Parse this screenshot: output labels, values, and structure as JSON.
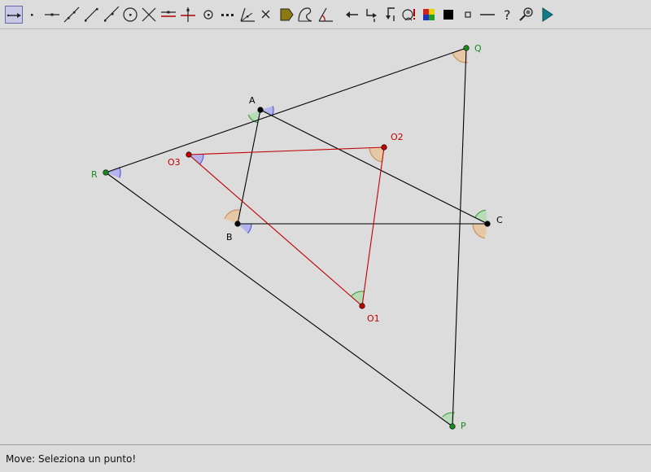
{
  "toolbar": {
    "tools": [
      {
        "name": "move-tool-icon",
        "selected": true
      },
      {
        "name": "new-point-icon"
      },
      {
        "name": "point-on-line-icon"
      },
      {
        "name": "line-through-two-points-icon"
      },
      {
        "name": "segment-icon"
      },
      {
        "name": "ray-icon"
      },
      {
        "name": "circle-icon"
      },
      {
        "name": "intersect-icon"
      },
      {
        "name": "parallel-line-icon"
      },
      {
        "name": "perpendicular-line-icon"
      },
      {
        "name": "midpoint-icon"
      },
      {
        "name": "dotted-line-icon"
      },
      {
        "name": "angle-bisector-icon"
      },
      {
        "name": "delete-x-icon"
      },
      {
        "name": "polygon-icon"
      },
      {
        "name": "locus-icon"
      },
      {
        "name": "angle-icon"
      },
      {
        "name": "translate-arrow-icon"
      },
      {
        "name": "rotate-icon"
      },
      {
        "name": "reflect-icon"
      },
      {
        "name": "macro-icon"
      },
      {
        "name": "color-palette-icon"
      },
      {
        "name": "fill-square-icon"
      },
      {
        "name": "small-square-icon"
      },
      {
        "name": "line-style-icon"
      },
      {
        "name": "help-question-icon"
      },
      {
        "name": "zoom-magnifier-icon"
      },
      {
        "name": "play-animation-icon"
      }
    ]
  },
  "colors": {
    "black": "#000000",
    "red_line": "#c00000",
    "green_point": "#1a8a1a",
    "angle_blue": "#5050d8",
    "angle_blue_fill": "#b4b4ec",
    "angle_orange": "#c8905a",
    "angle_orange_fill": "#e6c7a6",
    "angle_green": "#3a9a3a",
    "angle_green_fill": "#b8dcb8"
  },
  "labels": {
    "A": "A",
    "B": "B",
    "C": "C",
    "P": "P",
    "Q": "Q",
    "R": "R",
    "O1": "O1",
    "O2": "O2",
    "O3": "O3"
  },
  "status": {
    "text": "Move: Seleziona un punto!"
  }
}
